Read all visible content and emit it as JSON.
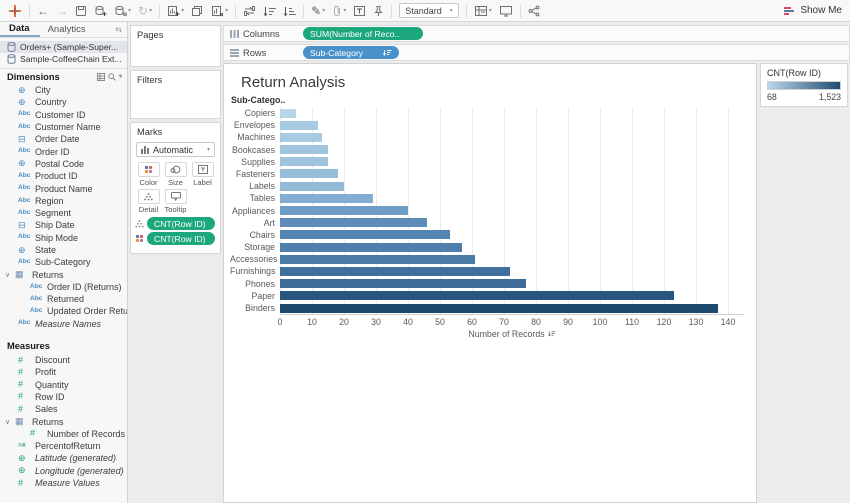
{
  "toolbar": {
    "fit_mode": "Standard",
    "show_me_label": "Show Me"
  },
  "left_panel": {
    "tabs": {
      "data": "Data",
      "analytics": "Analytics"
    },
    "data_sources": [
      {
        "label": "Orders+ (Sample-Super...",
        "selected": true
      },
      {
        "label": "Sample-CoffeeChain Ext...",
        "selected": false
      }
    ],
    "dimensions_header": "Dimensions",
    "dimension_fields": [
      {
        "icon": "globe",
        "label": "City"
      },
      {
        "icon": "globe",
        "label": "Country"
      },
      {
        "icon": "abc",
        "label": "Customer ID"
      },
      {
        "icon": "abc",
        "label": "Customer Name"
      },
      {
        "icon": "calendar",
        "label": "Order Date"
      },
      {
        "icon": "abc",
        "label": "Order ID"
      },
      {
        "icon": "globe",
        "label": "Postal Code"
      },
      {
        "icon": "abc",
        "label": "Product ID"
      },
      {
        "icon": "abc",
        "label": "Product Name"
      },
      {
        "icon": "abc",
        "label": "Region"
      },
      {
        "icon": "abc",
        "label": "Segment"
      },
      {
        "icon": "calendar",
        "label": "Ship Date"
      },
      {
        "icon": "abc",
        "label": "Ship Mode"
      },
      {
        "icon": "globe",
        "label": "State"
      },
      {
        "icon": "abc",
        "label": "Sub-Category"
      },
      {
        "icon": "table",
        "label": "Returns",
        "group": true
      },
      {
        "icon": "abc",
        "label": "Order ID (Returns)",
        "indent": true
      },
      {
        "icon": "abc",
        "label": "Returned",
        "indent": true
      },
      {
        "icon": "abc",
        "label": "Updated Order Returns",
        "indent": true
      },
      {
        "icon": "abc",
        "label": "Measure Names",
        "italic": true
      }
    ],
    "measures_header": "Measures",
    "measure_fields": [
      {
        "icon": "num",
        "label": "Discount"
      },
      {
        "icon": "num",
        "label": "Profit"
      },
      {
        "icon": "num",
        "label": "Quantity"
      },
      {
        "icon": "num",
        "label": "Row ID"
      },
      {
        "icon": "num",
        "label": "Sales"
      },
      {
        "icon": "table",
        "label": "Returns",
        "group": true
      },
      {
        "icon": "num",
        "label": "Number of Records",
        "indent": true
      },
      {
        "icon": "calc",
        "label": "PercentofReturn"
      },
      {
        "icon": "globe-green",
        "label": "Latitude (generated)",
        "italic": true
      },
      {
        "icon": "globe-green",
        "label": "Longitude (generated)",
        "italic": true
      },
      {
        "icon": "num",
        "label": "Measure Values",
        "italic": true
      }
    ]
  },
  "cards": {
    "pages_label": "Pages",
    "filters_label": "Filters",
    "marks": {
      "label": "Marks",
      "mark_type": "Automatic",
      "buttons": {
        "color": "Color",
        "size": "Size",
        "text_label": "Label",
        "detail": "Detail",
        "tooltip": "Tooltip"
      },
      "pills": [
        {
          "target": "detail",
          "label": "CNT(Row ID)"
        },
        {
          "target": "color",
          "label": "CNT(Row ID)"
        }
      ]
    }
  },
  "shelves": {
    "columns_label": "Columns",
    "columns_pill": "SUM(Number of Reco..",
    "rows_label": "Rows",
    "rows_pill": "Sub-Category"
  },
  "sheet_title": "Return Analysis",
  "chart_data": {
    "type": "bar",
    "orientation": "horizontal",
    "title": "Return Analysis",
    "row_axis_header": "Sub-Catego..",
    "categories": [
      "Copiers",
      "Envelopes",
      "Machines",
      "Bookcases",
      "Supplies",
      "Fasteners",
      "Labels",
      "Tables",
      "Appliances",
      "Art",
      "Chairs",
      "Storage",
      "Accessories",
      "Furnishings",
      "Phones",
      "Paper",
      "Binders"
    ],
    "values": [
      5,
      12,
      13,
      15,
      15,
      18,
      20,
      29,
      40,
      46,
      53,
      57,
      61,
      72,
      77,
      123,
      137
    ],
    "bar_colors": [
      "#b8d6e9",
      "#a6cbe3",
      "#a6cbe3",
      "#9fc4dd",
      "#9fc4dd",
      "#97bed9",
      "#92bad6",
      "#82add0",
      "#6f9cc4",
      "#5d8cb8",
      "#5484b1",
      "#4f7fab",
      "#4a7aa6",
      "#40719d",
      "#3c6c97",
      "#28567f",
      "#1f4a70"
    ],
    "xlabel": "Number of Records",
    "xticks": [
      0,
      10,
      20,
      30,
      40,
      50,
      60,
      70,
      80,
      90,
      100,
      110,
      120,
      130,
      140
    ],
    "xlim": [
      0,
      145
    ],
    "sort": "ascending-by-value-top-to-bottom",
    "grid": true,
    "legend_position": "top-right"
  },
  "legend": {
    "title": "CNT(Row ID)",
    "min_label": "68",
    "max_label": "1,523",
    "gradient_start": "#b9d7ea",
    "gradient_end": "#1f4a70"
  },
  "colors": {
    "pill_green": "#1ca87c",
    "pill_blue": "#4a91c9",
    "dimension_icon": "#4c8cbf",
    "measure_icon": "#27a081"
  }
}
